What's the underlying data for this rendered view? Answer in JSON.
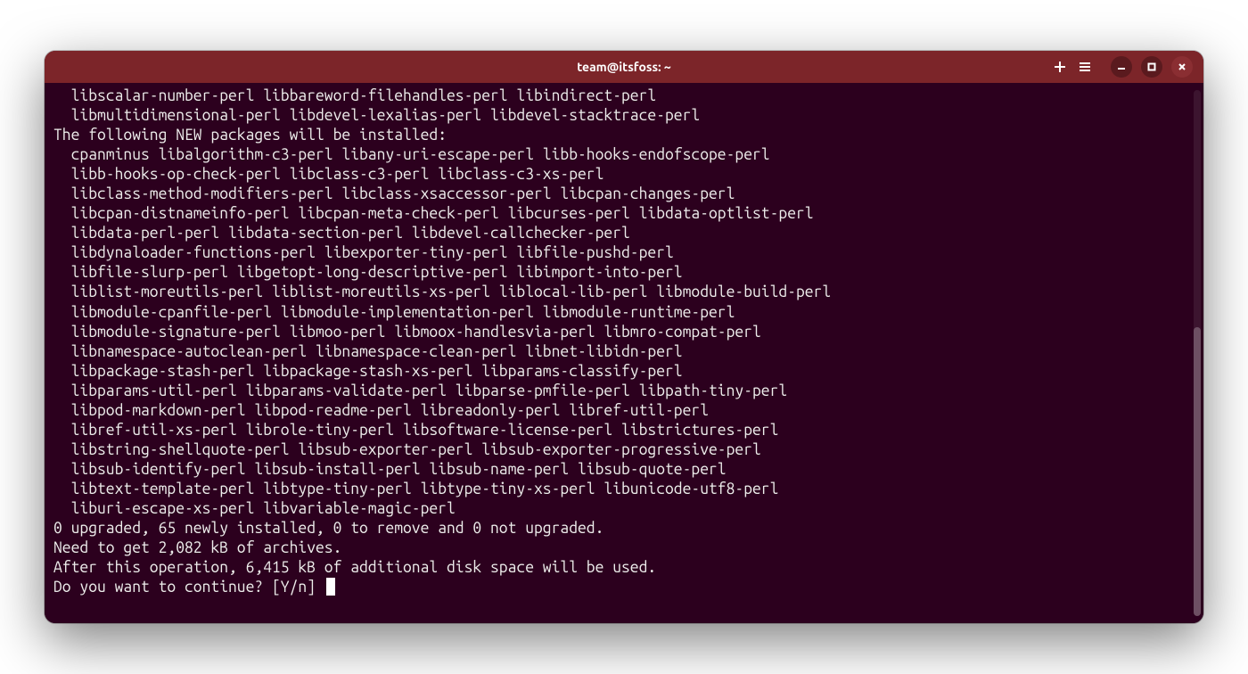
{
  "titlebar": {
    "title": "team@itsfoss: ~"
  },
  "terminal": {
    "lines": [
      "  libscalar-number-perl libbareword-filehandles-perl libindirect-perl",
      "  libmultidimensional-perl libdevel-lexalias-perl libdevel-stacktrace-perl",
      "The following NEW packages will be installed:",
      "  cpanminus libalgorithm-c3-perl libany-uri-escape-perl libb-hooks-endofscope-perl",
      "  libb-hooks-op-check-perl libclass-c3-perl libclass-c3-xs-perl",
      "  libclass-method-modifiers-perl libclass-xsaccessor-perl libcpan-changes-perl",
      "  libcpan-distnameinfo-perl libcpan-meta-check-perl libcurses-perl libdata-optlist-perl",
      "  libdata-perl-perl libdata-section-perl libdevel-callchecker-perl",
      "  libdynaloader-functions-perl libexporter-tiny-perl libfile-pushd-perl",
      "  libfile-slurp-perl libgetopt-long-descriptive-perl libimport-into-perl",
      "  liblist-moreutils-perl liblist-moreutils-xs-perl liblocal-lib-perl libmodule-build-perl",
      "  libmodule-cpanfile-perl libmodule-implementation-perl libmodule-runtime-perl",
      "  libmodule-signature-perl libmoo-perl libmoox-handlesvia-perl libmro-compat-perl",
      "  libnamespace-autoclean-perl libnamespace-clean-perl libnet-libidn-perl",
      "  libpackage-stash-perl libpackage-stash-xs-perl libparams-classify-perl",
      "  libparams-util-perl libparams-validate-perl libparse-pmfile-perl libpath-tiny-perl",
      "  libpod-markdown-perl libpod-readme-perl libreadonly-perl libref-util-perl",
      "  libref-util-xs-perl librole-tiny-perl libsoftware-license-perl libstrictures-perl",
      "  libstring-shellquote-perl libsub-exporter-perl libsub-exporter-progressive-perl",
      "  libsub-identify-perl libsub-install-perl libsub-name-perl libsub-quote-perl",
      "  libtext-template-perl libtype-tiny-perl libtype-tiny-xs-perl libunicode-utf8-perl",
      "  liburi-escape-xs-perl libvariable-magic-perl",
      "0 upgraded, 65 newly installed, 0 to remove and 0 not upgraded.",
      "Need to get 2,082 kB of archives.",
      "After this operation, 6,415 kB of additional disk space will be used.",
      "Do you want to continue? [Y/n]"
    ]
  }
}
